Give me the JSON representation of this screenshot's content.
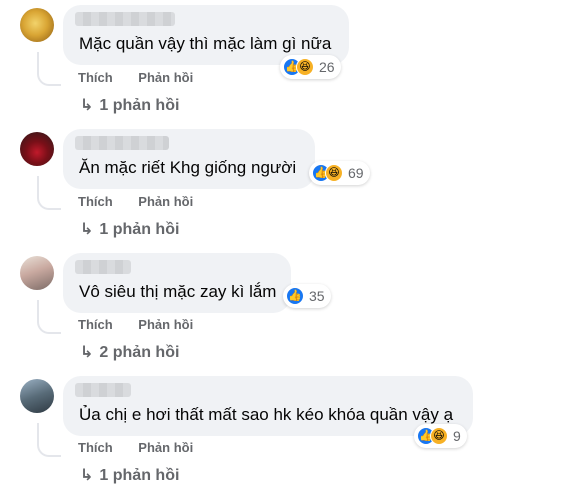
{
  "icons": {
    "like": "like-icon",
    "haha": "haha-icon",
    "reply_arrow": "reply-arrow-icon"
  },
  "colors": {
    "bubble": "#f0f2f5",
    "like": "#1877f2",
    "haha": "#f7b125",
    "secondary_text": "#65676b"
  },
  "comments": [
    {
      "text": "Mặc quần vậy thì mặc làm gì nữa",
      "reaction_count": "26",
      "like_label": "Thích",
      "reply_label": "Phản hồi",
      "replies_text": "1 phản hồi"
    },
    {
      "text": "Ăn mặc riết Khg giống người",
      "reaction_count": "69",
      "like_label": "Thích",
      "reply_label": "Phản hồi",
      "replies_text": "1 phản hồi"
    },
    {
      "text": "Vô siêu thị mặc zay kì lắm",
      "reaction_count": "35",
      "like_label": "Thích",
      "reply_label": "Phản hồi",
      "replies_text": "2 phản hồi"
    },
    {
      "text": "Ủa chị e hơi thất mất sao hk kéo khóa quần vậy ạ",
      "reaction_count": "9",
      "like_label": "Thích",
      "reply_label": "Phản hồi",
      "replies_text": "1 phản hồi"
    }
  ]
}
